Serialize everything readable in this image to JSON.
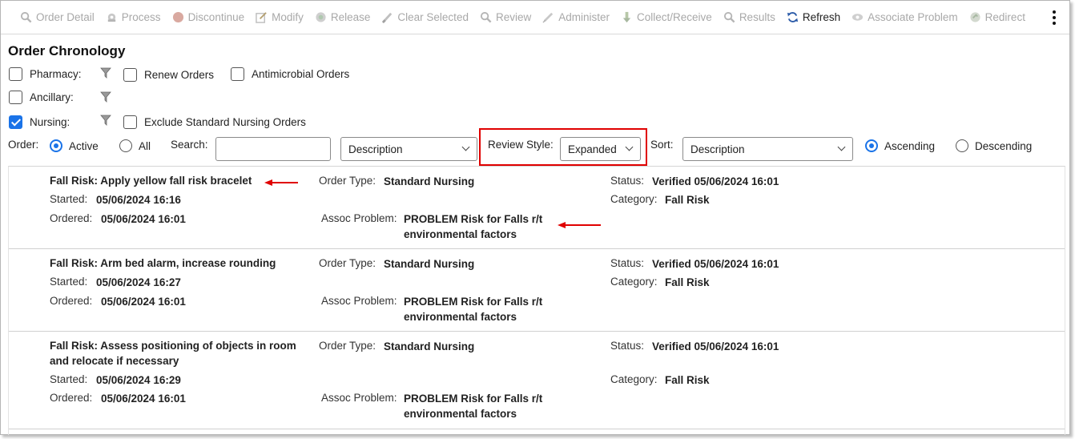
{
  "toolbar": {
    "buttons": [
      {
        "label": "Order Detail",
        "icon": "magnifier-icon",
        "enabled": false
      },
      {
        "label": "Process",
        "icon": "process-icon",
        "enabled": false
      },
      {
        "label": "Discontinue",
        "icon": "stop-icon",
        "enabled": false
      },
      {
        "label": "Modify",
        "icon": "edit-icon",
        "enabled": false
      },
      {
        "label": "Release",
        "icon": "release-icon",
        "enabled": false
      },
      {
        "label": "Clear Selected",
        "icon": "eraser-icon",
        "enabled": false
      },
      {
        "label": "Review",
        "icon": "magnifier-icon",
        "enabled": false
      },
      {
        "label": "Administer",
        "icon": "syringe-icon",
        "enabled": false
      },
      {
        "label": "Collect/Receive",
        "icon": "collect-icon",
        "enabled": false
      },
      {
        "label": "Results",
        "icon": "magnifier-icon",
        "enabled": false
      },
      {
        "label": "Refresh",
        "icon": "refresh-icon",
        "enabled": true
      },
      {
        "label": "Associate Problem",
        "icon": "eye-icon",
        "enabled": false
      },
      {
        "label": "Redirect",
        "icon": "redirect-icon",
        "enabled": false
      }
    ]
  },
  "page_title": "Order Chronology",
  "filters": {
    "pharmacy": {
      "label": "Pharmacy:",
      "checked": false
    },
    "renew_orders": {
      "label": "Renew Orders",
      "checked": false
    },
    "antimicrobial_orders": {
      "label": "Antimicrobial Orders",
      "checked": false
    },
    "ancillary": {
      "label": "Ancillary:",
      "checked": false
    },
    "nursing": {
      "label": "Nursing:",
      "checked": true
    },
    "exclude_standard_nursing": {
      "label": "Exclude Standard Nursing Orders",
      "checked": false
    }
  },
  "controls": {
    "order_label": "Order:",
    "active_label": "Active",
    "all_label": "All",
    "search_label": "Search:",
    "search_value": "",
    "search_field_value": "Description",
    "review_style_label": "Review Style:",
    "review_style_value": "Expanded",
    "sort_label": "Sort:",
    "sort_value": "Description",
    "ascending_label": "Ascending",
    "descending_label": "Descending"
  },
  "field_labels": {
    "started": "Started:",
    "ordered": "Ordered:",
    "order_type": "Order Type:",
    "assoc_problem": "Assoc Problem:",
    "status": "Status:",
    "category": "Category:"
  },
  "orders": [
    {
      "title": "Fall Risk: Apply yellow fall risk bracelet",
      "started": "05/06/2024 16:16",
      "ordered": "05/06/2024 16:01",
      "order_type": "Standard Nursing",
      "assoc_problem_line1": "PROBLEM Risk for Falls r/t",
      "assoc_problem_line2": "environmental factors",
      "status": "Verified 05/06/2024 16:01",
      "category": "Fall Risk"
    },
    {
      "title": "Fall Risk: Arm bed alarm, increase rounding",
      "started": "05/06/2024 16:27",
      "ordered": "05/06/2024 16:01",
      "order_type": "Standard Nursing",
      "assoc_problem_line1": "PROBLEM Risk for Falls r/t",
      "assoc_problem_line2": "environmental factors",
      "status": "Verified 05/06/2024 16:01",
      "category": "Fall Risk"
    },
    {
      "title": "Fall Risk: Assess positioning of objects in room and relocate if necessary",
      "started": "05/06/2024 16:29",
      "ordered": "05/06/2024 16:01",
      "order_type": "Standard Nursing",
      "assoc_problem_line1": "PROBLEM Risk for Falls r/t",
      "assoc_problem_line2": "environmental factors",
      "status": "Verified 05/06/2024 16:01",
      "category": "Fall Risk"
    }
  ],
  "colors": {
    "accent": "#1a73e8",
    "highlight": "#e00000",
    "disabled": "#a8a8a8"
  }
}
